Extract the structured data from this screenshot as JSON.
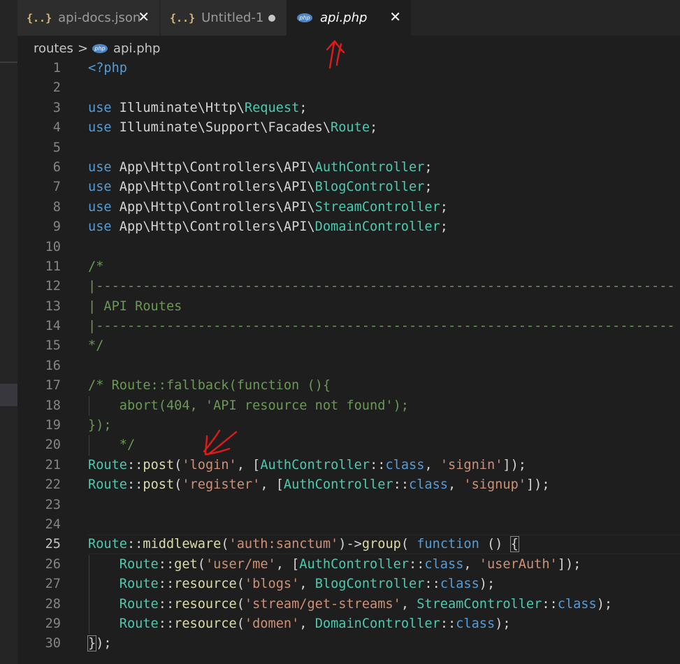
{
  "tabs": [
    {
      "icon": "{..}",
      "label": "api-docs.json"
    },
    {
      "icon": "{..}",
      "label": "Untitled-1"
    },
    {
      "icon": "php",
      "label": "api.php"
    }
  ],
  "breadcrumb": {
    "folder": "routes",
    "separator": ">",
    "icon": "php",
    "file": "api.php"
  },
  "lines": [
    {
      "n": "1"
    },
    {
      "n": "2"
    },
    {
      "n": "3"
    },
    {
      "n": "4"
    },
    {
      "n": "5"
    },
    {
      "n": "6"
    },
    {
      "n": "7"
    },
    {
      "n": "8"
    },
    {
      "n": "9"
    },
    {
      "n": "10"
    },
    {
      "n": "11"
    },
    {
      "n": "12"
    },
    {
      "n": "13"
    },
    {
      "n": "14"
    },
    {
      "n": "15"
    },
    {
      "n": "16"
    },
    {
      "n": "17"
    },
    {
      "n": "18"
    },
    {
      "n": "19"
    },
    {
      "n": "20"
    },
    {
      "n": "21"
    },
    {
      "n": "22"
    },
    {
      "n": "23"
    },
    {
      "n": "24"
    },
    {
      "n": "25"
    },
    {
      "n": "26"
    },
    {
      "n": "27"
    },
    {
      "n": "28"
    },
    {
      "n": "29"
    },
    {
      "n": "30"
    }
  ],
  "code": {
    "l1": "<?php",
    "use": "use",
    "l3_ns": " Illuminate\\Http\\",
    "l3_cls": "Request",
    "l4_ns": " Illuminate\\Support\\Facades\\",
    "l4_cls": "Route",
    "api_ns": " App\\Http\\Controllers\\API\\",
    "l6_cls": "AuthController",
    "l7_cls": "BlogController",
    "l8_cls": "StreamController",
    "l9_cls": "DomainController",
    "semi": ";",
    "l11": "/*",
    "l12": "|--------------------------------------------------------------------------",
    "l13": "| API Routes",
    "l14": "|--------------------------------------------------------------------------",
    "l15": "*/",
    "l17": "/* Route::fallback(function (){",
    "l18": "    abort(404, 'API resource not found');",
    "l19": "});",
    "l20": "    */",
    "route": "Route",
    "dc": "::",
    "post": "post",
    "s_login": "'login'",
    "s_signin": "'signin'",
    "s_register": "'register'",
    "s_signup": "'signup'",
    "authc": "AuthController",
    "blogc": "BlogController",
    "streamc": "StreamController",
    "domainc": "DomainController",
    "class": "class",
    "middleware": "middleware",
    "s_sanctum": "'auth:sanctum'",
    "arrow": "->",
    "group": "group",
    "function": "function",
    "get": "get",
    "resource": "resource",
    "s_userme": "'user/me'",
    "s_userauth": "'userAuth'",
    "s_blogs": "'blogs'",
    "s_streams": "'stream/get-streams'",
    "s_domen": "'domen'",
    "l30": "});"
  },
  "colors": {
    "keyword": "#569cd6",
    "class": "#4ec9b0",
    "function": "#dcdcaa",
    "string": "#ce9178",
    "comment": "#6a9955"
  }
}
